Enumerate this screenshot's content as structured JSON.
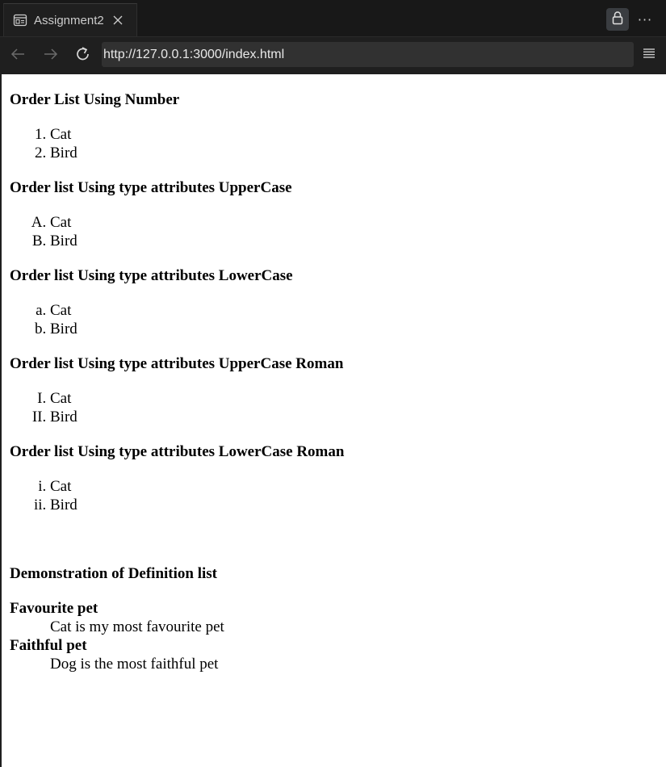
{
  "browser": {
    "tab_title": "Assignment2",
    "url": "http://127.0.0.1:3000/index.html",
    "icons": {
      "tab": "page-icon",
      "close": "close-icon",
      "lock": "lock-icon",
      "more": "more-icon",
      "back": "back-arrow-icon",
      "forward": "forward-arrow-icon",
      "reload": "reload-icon",
      "menu": "menu-icon"
    },
    "more_label": "···"
  },
  "content": {
    "lists": [
      {
        "heading": "Order List Using Number",
        "type": "1",
        "items": [
          "Cat",
          "Bird"
        ]
      },
      {
        "heading": "Order list Using type attributes UpperCase",
        "type": "A",
        "items": [
          "Cat",
          "Bird"
        ]
      },
      {
        "heading": "Order list Using type attributes LowerCase",
        "type": "a",
        "items": [
          "Cat",
          "Bird"
        ]
      },
      {
        "heading": "Order list Using type attributes UpperCase Roman",
        "type": "I",
        "items": [
          "Cat",
          "Bird"
        ]
      },
      {
        "heading": "Order list Using type attributes LowerCase Roman",
        "type": "i",
        "items": [
          "Cat",
          "Bird"
        ]
      }
    ],
    "definition": {
      "heading": "Demonstration of Definition list",
      "terms": [
        {
          "term": "Favourite pet",
          "desc": "Cat is my most favourite pet"
        },
        {
          "term": "Faithful pet",
          "desc": "Dog is the most faithful pet"
        }
      ]
    }
  }
}
